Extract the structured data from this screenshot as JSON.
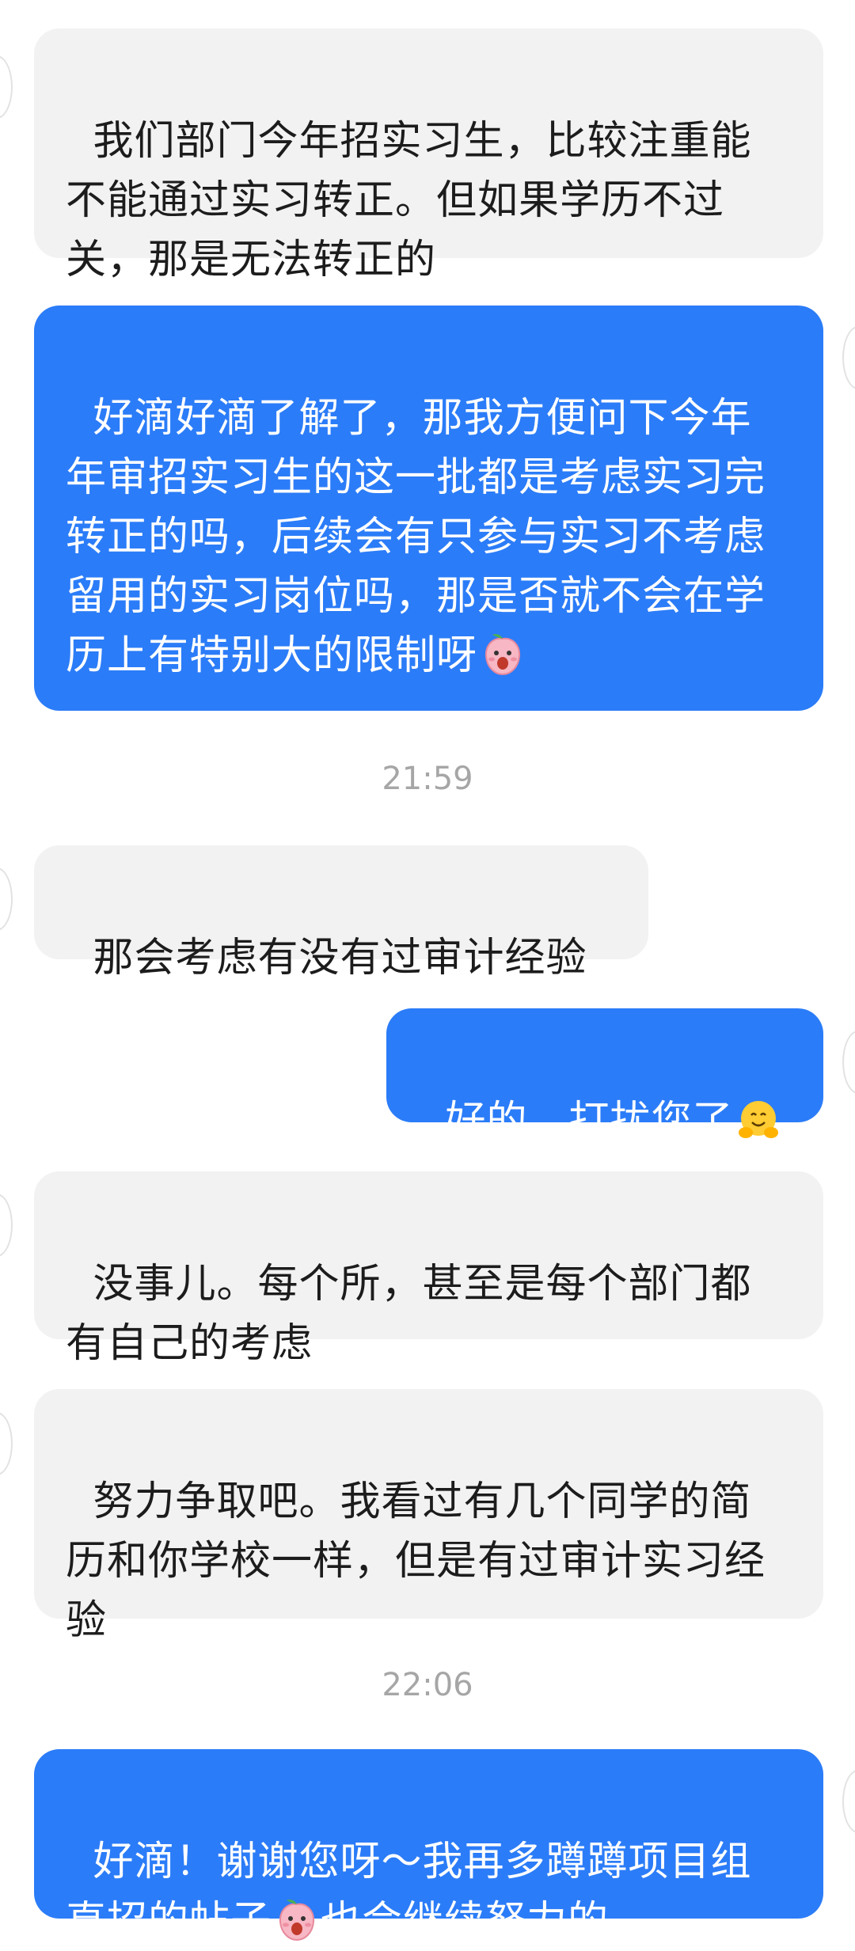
{
  "messages": [
    {
      "side": "in",
      "text": "我们部门今年招实习生，比较注重能不能通过实习转正。但如果学历不过关，那是无法转正的"
    },
    {
      "side": "out",
      "text": "好滴好滴了解了，那我方便问下今年年审招实习生的这一批都是考虑实习完转正的吗，后续会有只参与实习不考虑留用的实习岗位吗，那是否就不会在学历上有特别大的限制呀",
      "emoji": "peach-face-emoji"
    },
    {
      "side": "time",
      "text": "21:59"
    },
    {
      "side": "in",
      "text": "那会考虑有没有过审计经验"
    },
    {
      "side": "out",
      "text": "好的，打扰您了",
      "emoji": "hugging-face-emoji"
    },
    {
      "side": "in",
      "text": "没事儿。每个所，甚至是每个部门都有自己的考虑"
    },
    {
      "side": "in",
      "text": "努力争取吧。我看过有几个同学的简历和你学校一样，但是有过审计实习经验"
    },
    {
      "side": "time",
      "text": "22:06"
    },
    {
      "side": "out",
      "text_a": "好滴！谢谢您呀～我再多蹲蹲项目组直招的帖子",
      "emoji": "peach-face-emoji",
      "text_b": "也会继续努力的"
    }
  ],
  "colors": {
    "outgoing": "#2b7cf8",
    "incoming": "#f2f2f2",
    "timestamp": "#a6a6a6"
  }
}
